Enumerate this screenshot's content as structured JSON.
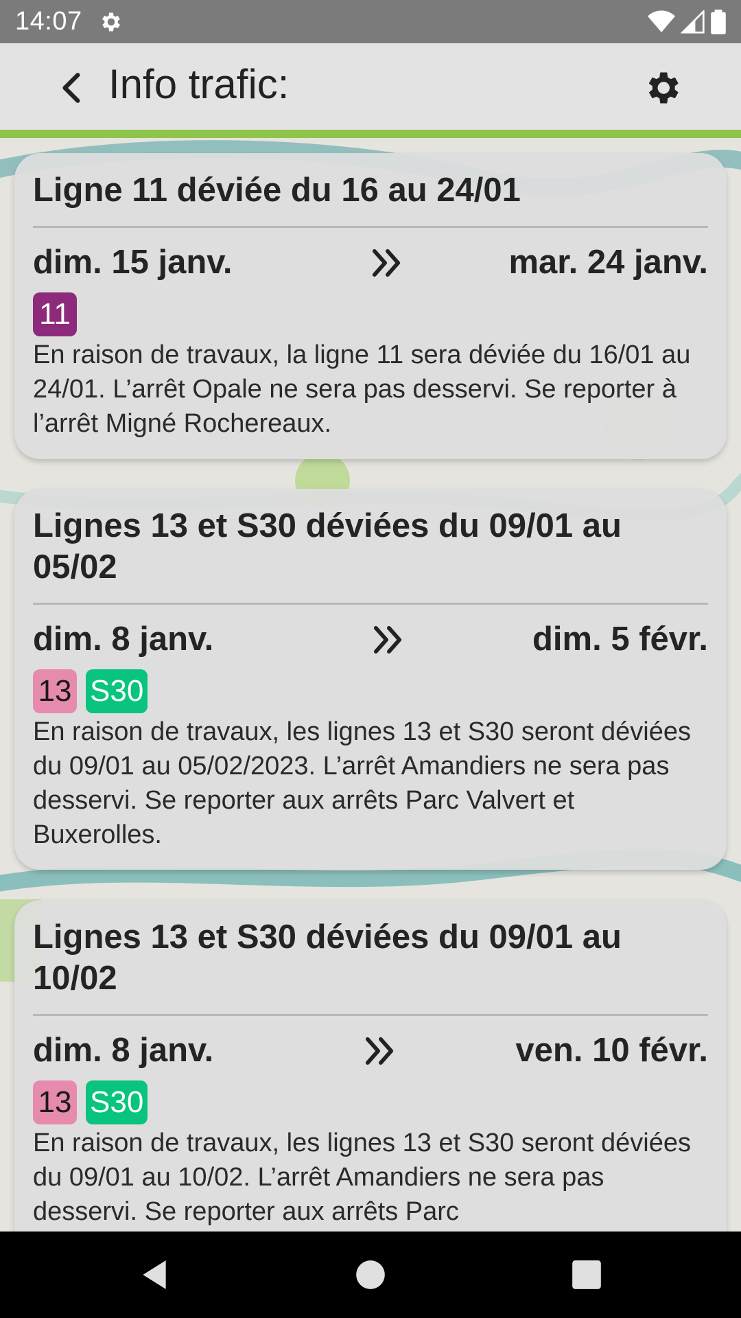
{
  "status_bar": {
    "time": "14:07",
    "icons": [
      "settings-icon",
      "wifi-icon",
      "signal-icon",
      "battery-icon"
    ]
  },
  "app_bar": {
    "back_icon": "chevron-left-icon",
    "title": "Info trafic:",
    "settings_icon": "gear-icon",
    "accent_color": "#8ec449"
  },
  "cards": [
    {
      "title": "Ligne 11 déviée du 16 au 24/01",
      "start_date": "dim. 15 janv.",
      "end_date": "mar. 24 janv.",
      "lines": [
        {
          "label": "11",
          "bg": "#8e2a7b",
          "fg": "#ffffff"
        }
      ],
      "description": "En raison de travaux, la ligne 11 sera déviée du 16/01 au 24/01. L’arrêt Opale ne sera pas desservi. Se reporter à l’arrêt Migné Rochereaux."
    },
    {
      "title": "Lignes 13 et S30 déviées du 09/01 au 05/02",
      "start_date": "dim. 8 janv.",
      "end_date": "dim. 5 févr.",
      "lines": [
        {
          "label": "13",
          "bg": "#e68aae",
          "fg": "#1a1a1a"
        },
        {
          "label": "S30",
          "bg": "#08c47e",
          "fg": "#ffffff"
        }
      ],
      "description": "En raison de travaux, les lignes 13 et S30 seront déviées du 09/01 au 05/02/2023. L’arrêt Amandiers ne sera pas desservi. Se reporter aux arrêts Parc Valvert et Buxerolles."
    },
    {
      "title": "Lignes 13 et S30 déviées du 09/01 au 10/02",
      "start_date": "dim. 8 janv.",
      "end_date": "ven. 10 févr.",
      "lines": [
        {
          "label": "13",
          "bg": "#e68aae",
          "fg": "#1a1a1a"
        },
        {
          "label": "S30",
          "bg": "#08c47e",
          "fg": "#ffffff"
        }
      ],
      "description": "En raison de travaux, les lignes 13 et S30 seront déviées du 09/01 au 10/02. L’arrêt Amandiers ne sera pas desservi. Se reporter aux arrêts Parc"
    }
  ],
  "nav_bar": {
    "icons": [
      "back-triangle-icon",
      "home-circle-icon",
      "recents-square-icon"
    ]
  }
}
